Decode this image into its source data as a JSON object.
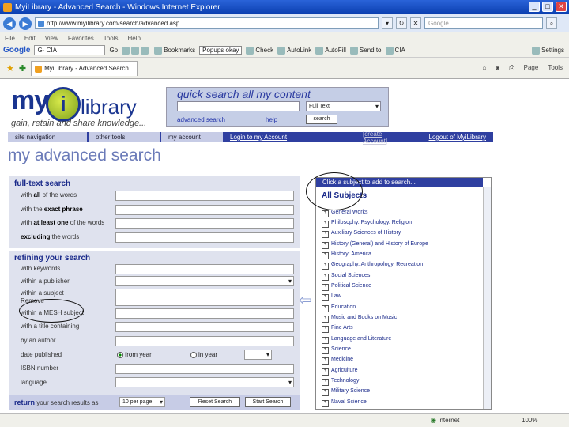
{
  "browser": {
    "title": "MyiLibrary - Advanced Search - Windows Internet Explorer",
    "url": "http://www.myilibrary.com/search/advanced.asp",
    "search_placeholder": "Google",
    "menu": [
      "File",
      "Edit",
      "View",
      "Favorites",
      "Tools",
      "Help"
    ],
    "gtoolbar": {
      "logo": "Google",
      "query": "G· CIA",
      "go": "Go",
      "bookmarks": "Bookmarks",
      "popups": "Popups okay",
      "check": "Check",
      "autolink": "AutoLink",
      "autofill": "AutoFill",
      "sendto": "Send to",
      "cia": "CIA",
      "settings": "Settings"
    },
    "tab_label": "MyiLibrary - Advanced Search",
    "tab_tools": [
      "Page",
      "Tools"
    ],
    "status_internet": "Internet",
    "zoom": "100%"
  },
  "logo": {
    "my": "my",
    "i": "i",
    "library": "library",
    "tagline": "gain, retain and share knowledge..."
  },
  "quick_search": {
    "title": "quick search all my content",
    "select": "Full Text",
    "advanced": "advanced search",
    "help": "help",
    "button": "search"
  },
  "nav": {
    "site_navigation": "site navigation",
    "other_tools": "other tools",
    "my_account": "my account",
    "login": "Login to my Account",
    "create": "[create Account]",
    "logout": "Logout of MyiLibrary"
  },
  "page_title": "my advanced search",
  "fulltext": {
    "heading": "full-text search",
    "all": {
      "pre": "with ",
      "bold": "all",
      "post": " of the words"
    },
    "exact": {
      "pre": "with the ",
      "bold": "exact phrase",
      "post": ""
    },
    "atleast": {
      "pre": "with ",
      "bold": "at least one",
      "post": " of the words"
    },
    "excluding": {
      "pre": "",
      "bold": "excluding",
      "post": " the words"
    }
  },
  "refine": {
    "heading": "refining your search",
    "keywords": "with keywords",
    "publisher": "within a publisher",
    "subject": "within a subject",
    "remove": "Remove",
    "mesh": "within a MESH subject",
    "title": "with a title containing",
    "author": "by an author",
    "date": "date published",
    "from_year": "from year",
    "in_year": "in year",
    "isbn": "ISBN number",
    "language": "language"
  },
  "return": {
    "bold": "return",
    "rest": " your search results as",
    "per_page": "10 per page",
    "reset": "Reset Search",
    "start": "Start Search"
  },
  "subjects": {
    "header": "Click a subject to add to search...",
    "all": "All Subjects",
    "items": [
      "General Works",
      "Philosophy. Psychology. Religion",
      "Auxiliary Sciences of History",
      "History (General) and History of Europe",
      "History: America",
      "Geography. Anthropology. Recreation",
      "Social Sciences",
      "Political Science",
      "Law",
      "Education",
      "Music and Books on Music",
      "Fine Arts",
      "Language and Literature",
      "Science",
      "Medicine",
      "Agriculture",
      "Technology",
      "Military Science",
      "Naval Science"
    ]
  }
}
